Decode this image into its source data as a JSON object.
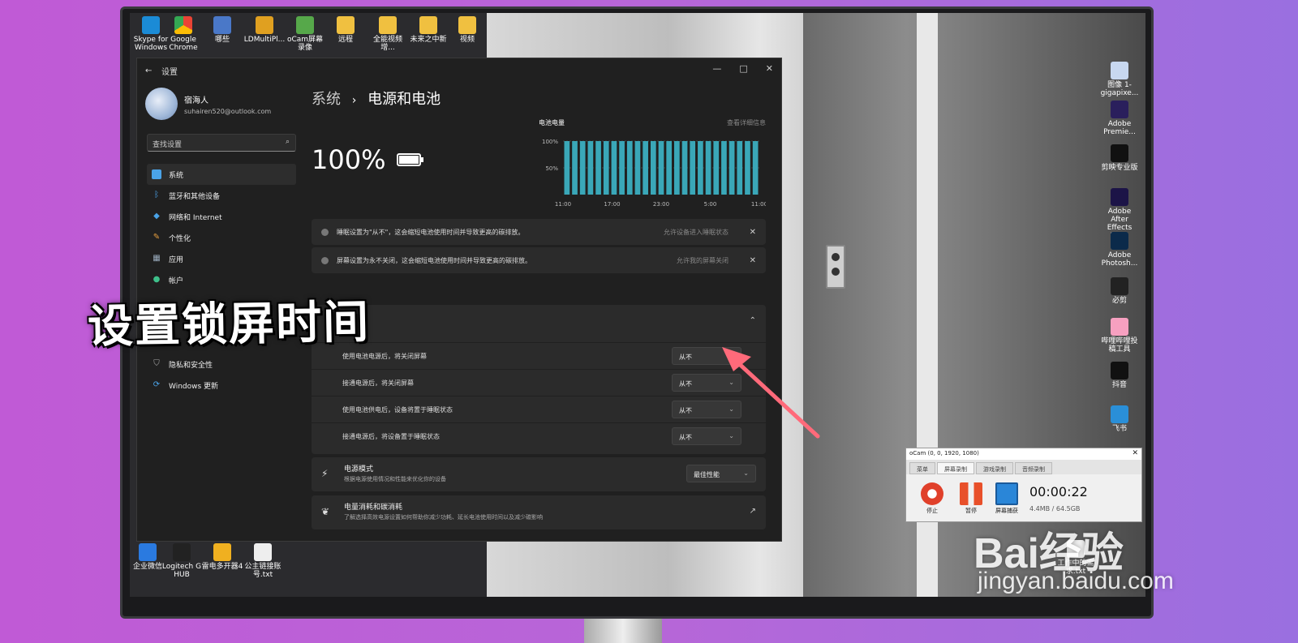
{
  "desktop": {
    "top_icons": [
      "Skype for Windows",
      "Google Chrome",
      "哪些",
      "LDMultiPl...",
      "oCam屏幕录像",
      "远程",
      "全能视频增...",
      "未来之中新",
      "视频"
    ],
    "right_icons": [
      "图像 1-gigapixe...",
      "Adobe Premie...",
      "剪映专业版",
      "Adobe After Effects 2022",
      "Adobe Photosh...",
      "必剪",
      "哔哩哔哩投稿工具",
      "抖音",
      "飞书"
    ],
    "bottom_icons": [
      "企业微信",
      "Logitech G HUB",
      "雷电多开器4",
      "公主链接账号.txt"
    ],
    "bottom_right_icon": "工作中的需求.txt"
  },
  "settings": {
    "window_title": "设置",
    "user_name": "宿海人",
    "user_email": "suhairen520@outlook.com",
    "search_placeholder": "查找设置",
    "nav": [
      {
        "label": "系统",
        "icon": "monitor-icon"
      },
      {
        "label": "蓝牙和其他设备",
        "icon": "bluetooth-icon"
      },
      {
        "label": "网络和 Internet",
        "icon": "wifi-icon"
      },
      {
        "label": "个性化",
        "icon": "brush-icon"
      },
      {
        "label": "应用",
        "icon": "apps-icon"
      },
      {
        "label": "帐户",
        "icon": "person-icon"
      },
      {
        "label": "隐私和安全性",
        "icon": "shield-icon"
      },
      {
        "label": "Windows 更新",
        "icon": "update-icon"
      }
    ],
    "breadcrumb_parent": "系统",
    "breadcrumb_sep": "›",
    "page_title": "电源和电池",
    "battery_percent": "100%",
    "chart_title": "电池电量",
    "chart_link": "查看详细信息",
    "notices": [
      {
        "text": "睡眠设置为\"从不\"，这会缩短电池使用时间并导致更高的碳排放。",
        "action": "允许设备进入睡眠状态"
      },
      {
        "text": "屏幕设置为永不关闭，这会缩短电池使用时间并导致更高的碳排放。",
        "action": "允许我的屏幕关闭"
      }
    ],
    "rows": [
      {
        "label": "使用电池电源后，将关闭屏幕",
        "value": "从不"
      },
      {
        "label": "接通电源后，将关闭屏幕",
        "value": "从不"
      },
      {
        "label": "使用电池供电后，设备将置于睡眠状态",
        "value": "从不"
      },
      {
        "label": "接通电源后，将设备置于睡眠状态",
        "value": "从不"
      }
    ],
    "power_mode_title": "电源模式",
    "power_mode_desc": "根据电源使用情况和性能来优化你的设备",
    "power_mode_value": "最佳性能",
    "energy_title": "电量消耗和碳消耗",
    "energy_desc": "了解选择高效电源设置如何帮助你减少功耗、延长电池使用时间以及减少碳影响"
  },
  "chart_data": {
    "type": "bar",
    "title": "电池电量",
    "x_ticks": [
      "11:00",
      "17:00",
      "23:00",
      "5:00",
      "11:00"
    ],
    "y_ticks": [
      "100%",
      "50%"
    ],
    "ylim": [
      0,
      100
    ],
    "values": [
      100,
      100,
      100,
      100,
      100,
      100,
      100,
      100,
      100,
      100,
      100,
      100,
      100,
      100,
      100,
      100,
      100,
      100,
      100,
      100,
      100,
      100,
      100,
      100,
      100
    ],
    "bar_color": "#3aa7b8"
  },
  "overlay_caption": "设置锁屏时间",
  "ocam": {
    "title": "oCam (0, 0, 1920, 1080)",
    "tabs": [
      "菜单",
      "屏幕录制",
      "游戏录制",
      "音频录制"
    ],
    "buttons": [
      "停止",
      "暂停",
      "屏幕捕获"
    ],
    "time": "00:00:22",
    "size": "4.4MB / 64.5GB"
  },
  "watermark": {
    "brand": "Bai经验",
    "url": "jingyan.baidu.com"
  }
}
